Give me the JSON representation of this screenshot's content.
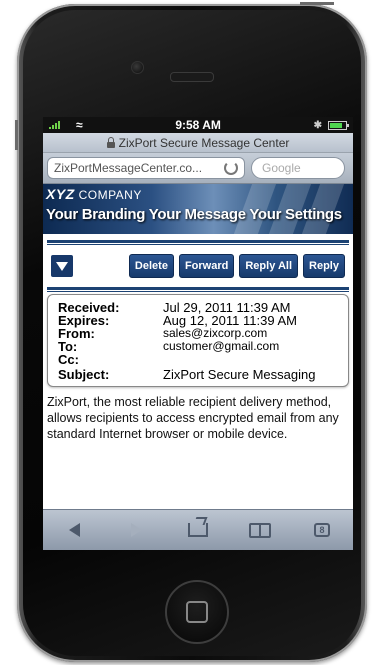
{
  "status": {
    "time": "9:58 AM"
  },
  "browser": {
    "page_title": "ZixPort Secure Message Center",
    "url": "ZixPortMessageCenter.co...",
    "search_placeholder": "Google"
  },
  "banner": {
    "company_prefix": "XYZ",
    "company_suffix": " COMPANY",
    "tagline": "Your Branding  Your Message  Your Settings"
  },
  "toolbar": {
    "delete": "Delete",
    "forward": "Forward",
    "reply_all": "Reply All",
    "reply": "Reply"
  },
  "message": {
    "headers": [
      {
        "label": "Received:",
        "value": "Jul 29, 2011 11:39 AM"
      },
      {
        "label": "Expires:",
        "value": "Aug 12, 2011 11:39 AM"
      },
      {
        "label": "From:",
        "value": "sales@zixcorp.com"
      },
      {
        "label": "To:",
        "value": "customer@gmail.com"
      },
      {
        "label": "Cc:",
        "value": ""
      },
      {
        "label": "Subject:",
        "value": "ZixPort Secure Messaging"
      }
    ],
    "body": "ZixPort, the most reliable recipient delivery method, allows recipients to access encrypted email from any standard Internet browser or mobile device."
  },
  "navbar": {
    "tab_count": "8"
  },
  "colors": {
    "accent": "#17386a",
    "button": "#1f4a85"
  }
}
